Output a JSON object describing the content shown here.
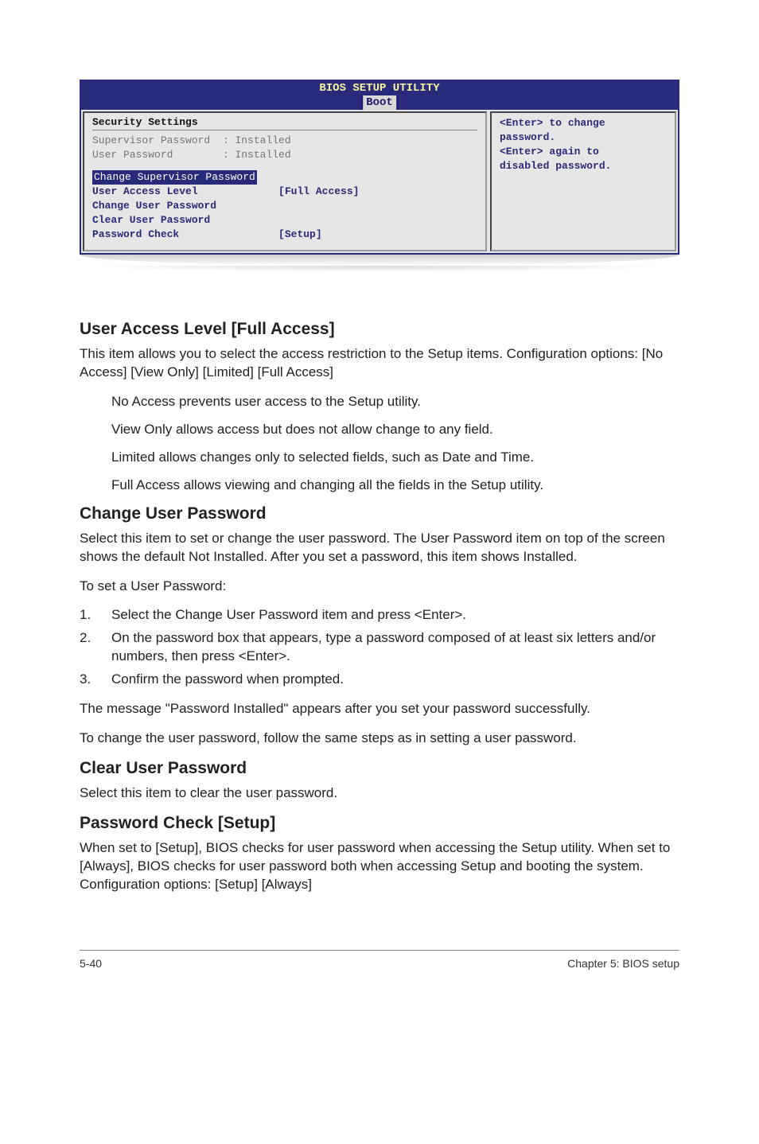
{
  "bios": {
    "title": "BIOS SETUP UTILITY",
    "tab": "Boot",
    "section_header": "Security Settings",
    "row_supervisor_label": "Supervisor Password",
    "row_supervisor_val": ": Installed",
    "row_user_label": "User Password",
    "row_user_val": ": Installed",
    "row_change_supervisor": "Change Supervisor Password",
    "row_access_level_label": "User Access Level",
    "row_access_level_val": "[Full Access]",
    "row_change_user": "Change User Password",
    "row_clear_user": "Clear User Password",
    "row_pwcheck_label": "Password Check",
    "row_pwcheck_val": "[Setup]",
    "help_l1": "<Enter> to change",
    "help_l2": "password.",
    "help_l3": "<Enter> again to",
    "help_l4": "disabled password."
  },
  "sections": {
    "ual_title": "User Access Level [Full Access]",
    "ual_p1": "This item allows you to select the access restriction to the Setup items. Configuration options: [No Access] [View Only] [Limited] [Full Access]",
    "ual_opt1": "No Access prevents user access to the Setup utility.",
    "ual_opt2": "View Only allows access but does not allow change to any field.",
    "ual_opt3": "Limited allows changes only to selected fields, such as Date and Time.",
    "ual_opt4": "Full Access allows viewing and changing all the fields in the Setup utility.",
    "cup_title": "Change User Password",
    "cup_p1": "Select this item to set or change the user password. The User Password item on top of the screen shows the default Not Installed. After you set a password, this item shows Installed.",
    "cup_p2": "To set a User Password:",
    "cup_li1": "Select the Change User Password item and press <Enter>.",
    "cup_li2": "On the password box that appears, type a password composed of at least six letters and/or numbers, then press <Enter>.",
    "cup_li3": "Confirm the password when prompted.",
    "cup_p3": "The message \"Password Installed\" appears after you set your password successfully.",
    "cup_p4": "To change the user password, follow the same steps as in setting a user password.",
    "clr_title": "Clear User Password",
    "clr_p1": "Select this item to clear the user password.",
    "pwc_title": "Password Check [Setup]",
    "pwc_p1": "When set to [Setup], BIOS checks for user password when accessing the Setup utility. When set to [Always], BIOS checks for user password both when accessing Setup and booting the system. Configuration options: [Setup] [Always]"
  },
  "footer": {
    "page": "5-40",
    "chapter": "Chapter 5: BIOS setup"
  },
  "nums": {
    "n1": "1.",
    "n2": "2.",
    "n3": "3."
  }
}
